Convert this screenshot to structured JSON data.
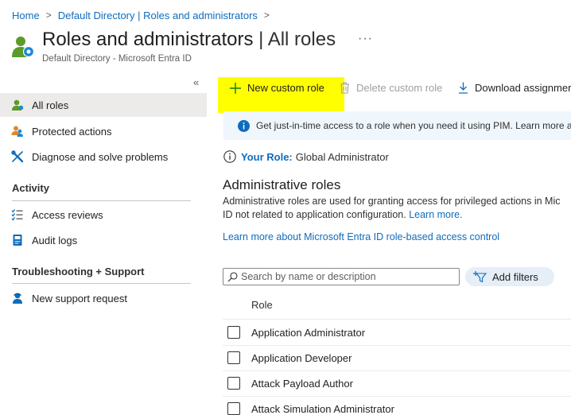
{
  "breadcrumb": {
    "items": [
      "Home",
      "Default Directory | Roles and administrators"
    ]
  },
  "header": {
    "title": "Roles and administrators",
    "title_suffix": "| All roles",
    "subtitle": "Default Directory - Microsoft Entra ID",
    "more_label": "···"
  },
  "sidebar": {
    "collapse_label": "«",
    "items": [
      {
        "label": "All roles",
        "icon": "user-icon"
      },
      {
        "label": "Protected actions",
        "icon": "users-icon"
      },
      {
        "label": "Diagnose and solve problems",
        "icon": "wrench-icon"
      }
    ],
    "sections": [
      {
        "heading": "Activity",
        "items": [
          {
            "label": "Access reviews",
            "icon": "list-check-icon"
          },
          {
            "label": "Audit logs",
            "icon": "log-book-icon"
          }
        ]
      },
      {
        "heading": "Troubleshooting + Support",
        "items": [
          {
            "label": "New support request",
            "icon": "support-person-icon"
          }
        ]
      }
    ]
  },
  "toolbar": {
    "new_custom_role": "New custom role",
    "delete_custom_role": "Delete custom role",
    "download_assignments": "Download assignmer"
  },
  "info_banner": {
    "text": "Get just-in-time access to a role when you need it using PIM. Learn more ab"
  },
  "your_role": {
    "key": "Your Role:",
    "value": "Global Administrator"
  },
  "admin_roles": {
    "heading": "Administrative roles",
    "desc_line1": "Administrative roles are used for granting access for privileged actions in Mic",
    "desc_line2": "ID not related to application configuration.",
    "learn_more": "Learn more.",
    "rbac_link": "Learn more about Microsoft Entra ID role-based access control"
  },
  "search": {
    "placeholder": "Search by name or description"
  },
  "filters": {
    "add_filters": "Add filters"
  },
  "table": {
    "column_header": "Role",
    "rows": [
      "Application Administrator",
      "Application Developer",
      "Attack Payload Author",
      "Attack Simulation Administrator"
    ]
  },
  "colors": {
    "accent": "#0f6cbd",
    "highlight": "#ffff00",
    "active_nav": "#edebe9",
    "banner_bg": "#eff6fc"
  }
}
